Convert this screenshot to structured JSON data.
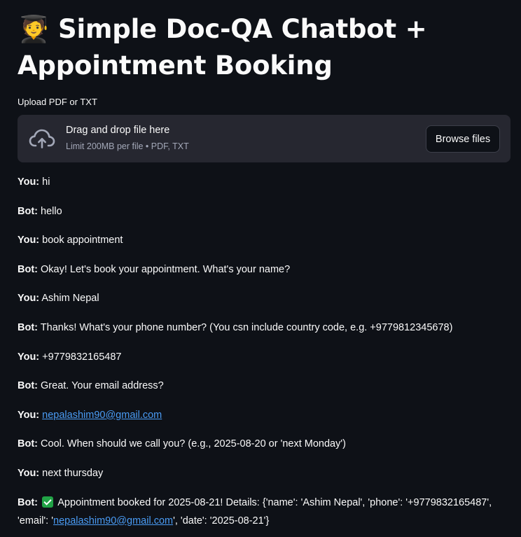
{
  "header": {
    "emoji": "🧑‍🎓",
    "title_line1": "Simple Doc-QA Chatbot +",
    "title_line2": "Appointment Booking"
  },
  "uploader": {
    "label": "Upload PDF or TXT",
    "drop_text": "Drag and drop file here",
    "limit_text": "Limit 200MB per file • PDF, TXT",
    "browse_label": "Browse files",
    "icon": "cloud-upload-icon"
  },
  "messages": [
    {
      "who": "You:",
      "text": "hi"
    },
    {
      "who": "Bot:",
      "text": "hello"
    },
    {
      "who": "You:",
      "text": "book appointment"
    },
    {
      "who": "Bot:",
      "text": "Okay! Let's book your appointment. What's your name?"
    },
    {
      "who": "You:",
      "text": "Ashim Nepal"
    },
    {
      "who": "Bot:",
      "text": "Thanks! What's your phone number? (You csn include country code, e.g. +9779812345678)"
    },
    {
      "who": "You:",
      "text": "+9779832165487"
    },
    {
      "who": "Bot:",
      "text": "Great. Your email address?"
    },
    {
      "who": "You:",
      "link": "nepalashim90@gmail.com"
    },
    {
      "who": "Bot:",
      "text": "Cool. When should we call you? (e.g., 2025-08-20 or 'next Monday')"
    },
    {
      "who": "You:",
      "text": "next thursday"
    }
  ],
  "final_message": {
    "who": "Bot:",
    "icon": "check-mark-icon",
    "text_before": "Appointment booked for 2025-08-21! Details: {'name': 'Ashim Nepal', 'phone': '+9779832165487', 'email': '",
    "link": "nepalashim90@gmail.com",
    "text_after": "', 'date': '2025-08-21'}"
  },
  "colors": {
    "background": "#0e1117",
    "surface": "#262730",
    "link": "#4a9cf5",
    "check": "#21a346"
  }
}
